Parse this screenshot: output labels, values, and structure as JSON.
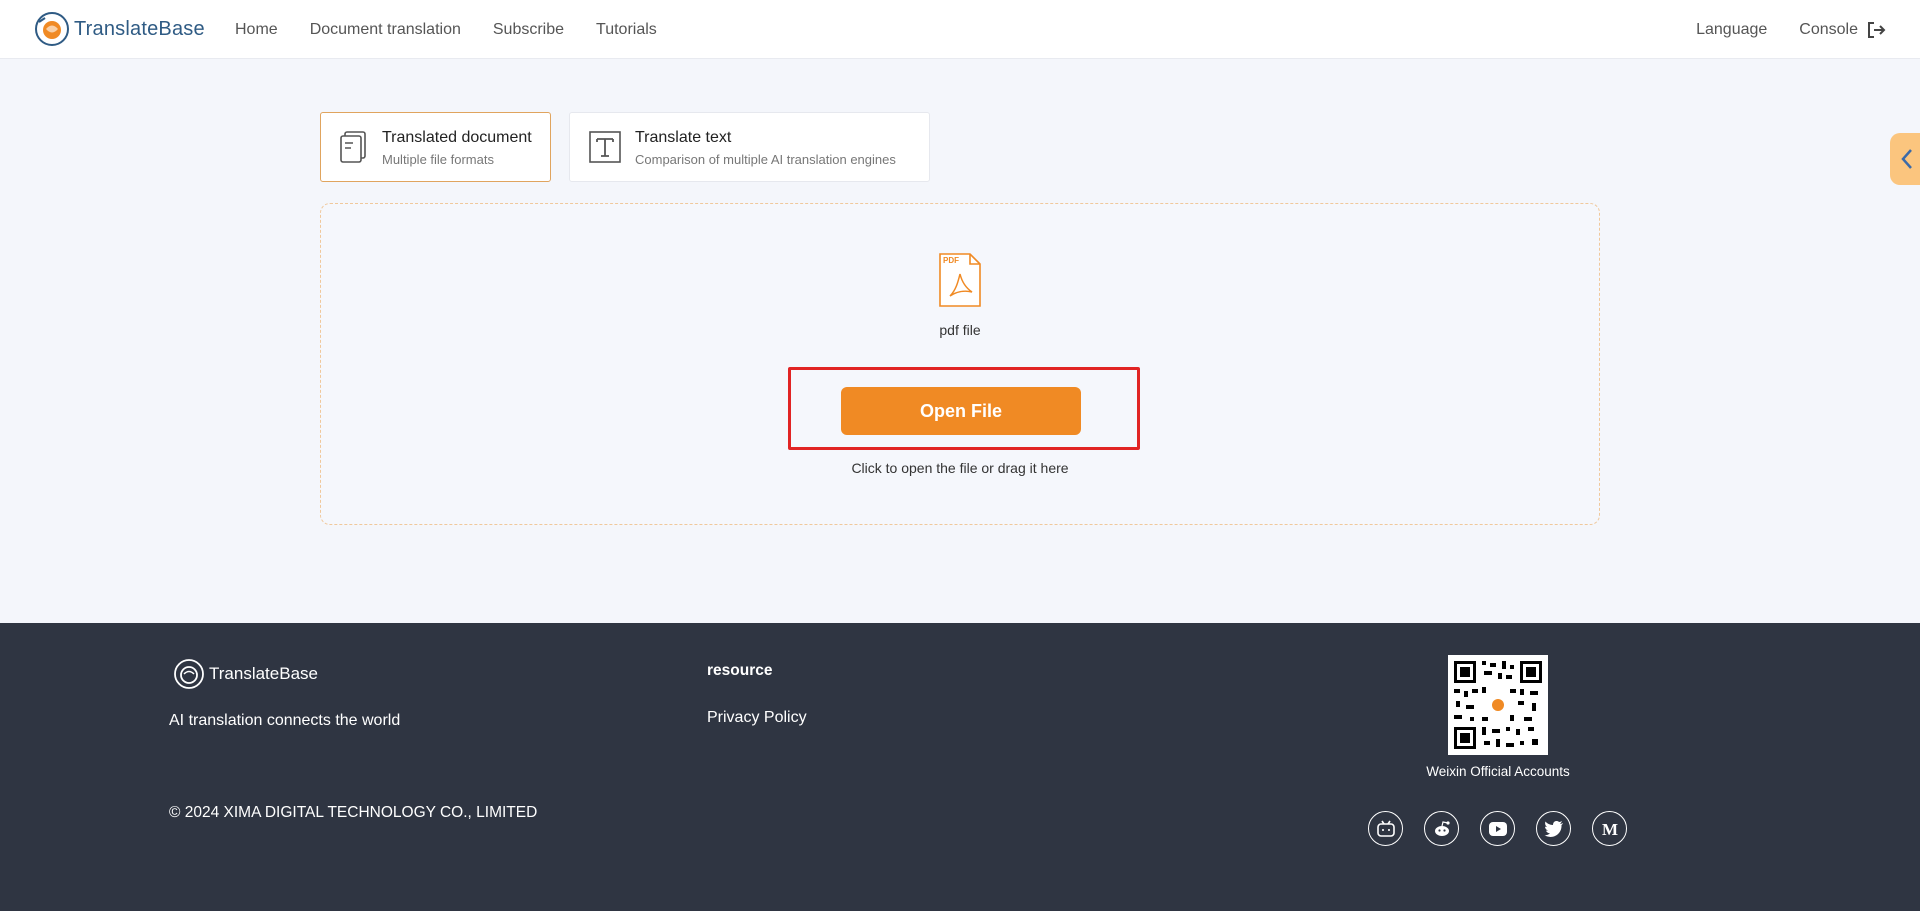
{
  "header": {
    "brand": "TranslateBase",
    "nav": [
      "Home",
      "Document translation",
      "Subscribe",
      "Tutorials"
    ],
    "language": "Language",
    "console": "Console"
  },
  "tabs": [
    {
      "title": "Translated document",
      "subtitle": "Multiple file formats"
    },
    {
      "title": "Translate text",
      "subtitle": "Comparison of multiple AI translation engines"
    }
  ],
  "upload": {
    "file_type": "pdf file",
    "button": "Open File",
    "hint": "Click to open the file or drag it here"
  },
  "footer": {
    "brand": "TranslateBase",
    "tagline": "AI translation connects the world",
    "copyright": "© 2024 XIMA DIGITAL TECHNOLOGY CO., LIMITED",
    "resource_title": "resource",
    "privacy": "Privacy Policy",
    "qr_label": "Weixin Official Accounts",
    "socials": [
      "bilibili-icon",
      "reddit-icon",
      "youtube-icon",
      "twitter-icon",
      "medium-icon"
    ]
  },
  "colors": {
    "accent": "#f08a24",
    "brand_blue": "#2f5b84",
    "footer_bg": "#2f3542",
    "highlight": "#e12424"
  }
}
